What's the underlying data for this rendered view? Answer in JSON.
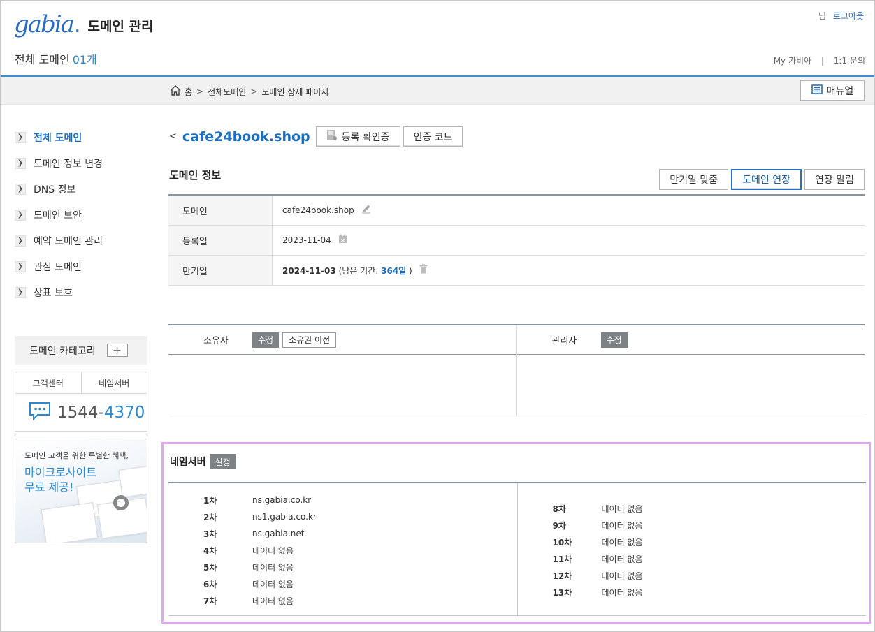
{
  "header": {
    "logo_text": "gabia",
    "logo_dot": ".",
    "title": "도메인 관리",
    "total_label": "전체 도메인",
    "total_count": "01개",
    "user_suffix": "님",
    "logout": "로그아웃",
    "my_gabia": "My 가비아",
    "divider": "|",
    "inquiry": "1:1 문의"
  },
  "breadcrumb": {
    "home": "홈",
    "sep1": ">",
    "level1": "전체도메인",
    "sep2": ">",
    "level2": "도메인 상세 페이지",
    "manual": "매뉴얼"
  },
  "sidebar": {
    "items": [
      {
        "label": "전체 도메인",
        "active": true
      },
      {
        "label": "도메인 정보 변경"
      },
      {
        "label": "DNS 정보"
      },
      {
        "label": "도메인 보안"
      },
      {
        "label": "예약 도메인 관리"
      },
      {
        "label": "관심 도메인"
      },
      {
        "label": "상표 보호"
      }
    ],
    "category": "도메인 카테고리",
    "category_plus": "+",
    "cs_tabs": [
      "고객센터",
      "네임서버"
    ],
    "phone_a": "1544-",
    "phone_b": "4370",
    "promo_small": "도메인 고객을 위한 특별한 혜택,",
    "promo_big1": "마이크로사이트",
    "promo_big2": "무료 제공!"
  },
  "domain": {
    "back": "<",
    "name": "cafe24book.shop",
    "cert_btn": "등록 확인증",
    "auth_btn": "인증 코드"
  },
  "info": {
    "title": "도메인 정보",
    "buttons": [
      "만기일 맞춤",
      "도메인 연장",
      "연장 알림"
    ],
    "rows": [
      {
        "label": "도메인",
        "value": "cafe24book.shop"
      },
      {
        "label": "등록일",
        "value": "2023-11-04"
      },
      {
        "label": "만기일",
        "value": "2024-11-03",
        "rest_prefix": "(남은 기간:",
        "rest_days": "364일",
        "rest_suffix": ")"
      }
    ]
  },
  "owner": {
    "owner_label": "소유자",
    "edit": "수정",
    "transfer": "소유권 이전",
    "admin_label": "관리자",
    "admin_edit": "수정"
  },
  "nameserver": {
    "title": "네임서버",
    "set_btn": "설정",
    "left": [
      {
        "k": "1차",
        "v": "ns.gabia.co.kr"
      },
      {
        "k": "2차",
        "v": "ns1.gabia.co.kr"
      },
      {
        "k": "3차",
        "v": "ns.gabia.net"
      },
      {
        "k": "4차",
        "v": "데이터 없음"
      },
      {
        "k": "5차",
        "v": "데이터 없음"
      },
      {
        "k": "6차",
        "v": "데이터 없음"
      },
      {
        "k": "7차",
        "v": "데이터 없음"
      }
    ],
    "right": [
      {
        "k": "8차",
        "v": "데이터 없음"
      },
      {
        "k": "9차",
        "v": "데이터 없음"
      },
      {
        "k": "10차",
        "v": "데이터 없음"
      },
      {
        "k": "11차",
        "v": "데이터 없음"
      },
      {
        "k": "12차",
        "v": "데이터 없음"
      },
      {
        "k": "13차",
        "v": "데이터 없음"
      }
    ]
  },
  "colors": {
    "brand": "#2a6ebd",
    "accent": "#2a89d1",
    "highlight_border": "#e3a6f2"
  }
}
